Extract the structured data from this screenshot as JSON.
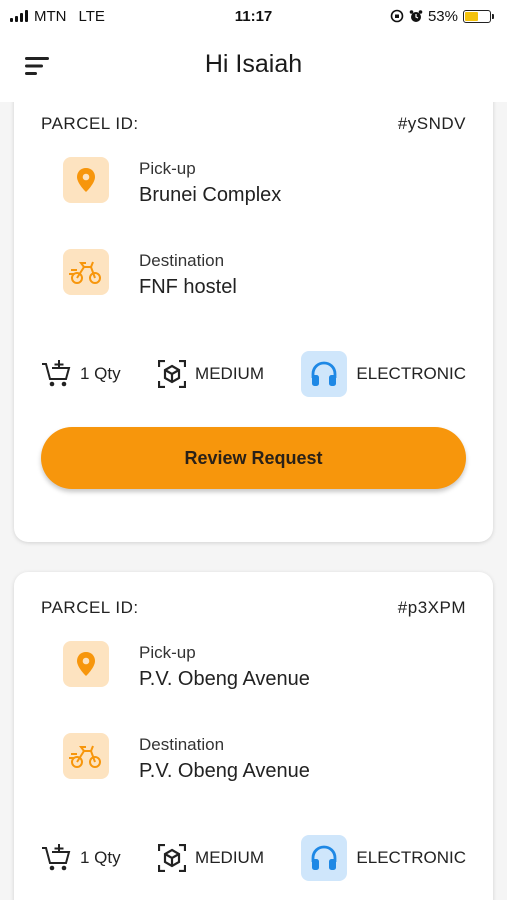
{
  "status_bar": {
    "carrier": "MTN",
    "network": "LTE",
    "time": "11:17",
    "battery_percent": "53%",
    "battery_level": 0.53
  },
  "header": {
    "title": "Hi Isaiah",
    "menu_icon": "sort-menu-icon"
  },
  "parcels": [
    {
      "id_label": "PARCEL ID:",
      "id": "#ySNDV",
      "pickup_label": "Pick-up",
      "pickup": "Brunei Complex",
      "destination_label": "Destination",
      "destination": "FNF hostel",
      "qty": "1 Qty",
      "size": "MEDIUM",
      "category": "ELECTRONIC",
      "button_label": "Review Request"
    },
    {
      "id_label": "PARCEL ID:",
      "id": "#p3XPM",
      "pickup_label": "Pick-up",
      "pickup": "P.V. Obeng Avenue",
      "destination_label": "Destination",
      "destination": "P.V. Obeng Avenue",
      "qty": "1 Qty",
      "size": "MEDIUM",
      "category": "ELECTRONIC"
    }
  ],
  "colors": {
    "accent": "#f7960c",
    "icon_bg_orange": "#fde3c0",
    "icon_bg_blue": "#cfe6fb",
    "icon_blue": "#1e88e5"
  }
}
